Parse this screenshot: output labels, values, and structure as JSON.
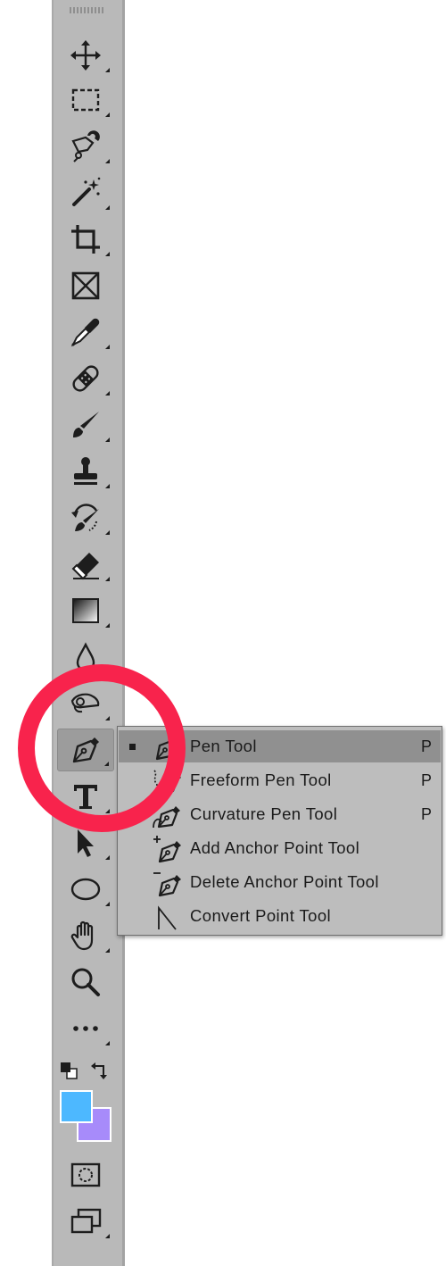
{
  "toolbar": {
    "tools": [
      {
        "name": "move-tool",
        "icon": "move-icon",
        "has_submenu": true
      },
      {
        "name": "rectangular-marquee-tool",
        "icon": "marquee-icon",
        "has_submenu": true
      },
      {
        "name": "magnetic-lasso-tool",
        "icon": "magnetic-lasso-icon",
        "has_submenu": true
      },
      {
        "name": "magic-wand-tool",
        "icon": "magic-wand-icon",
        "has_submenu": true
      },
      {
        "name": "crop-tool",
        "icon": "crop-icon",
        "has_submenu": true
      },
      {
        "name": "frame-tool",
        "icon": "frame-icon",
        "has_submenu": false
      },
      {
        "name": "eyedropper-tool",
        "icon": "eyedropper-icon",
        "has_submenu": true
      },
      {
        "name": "healing-brush-tool",
        "icon": "bandage-icon",
        "has_submenu": true
      },
      {
        "name": "brush-tool",
        "icon": "brush-icon",
        "has_submenu": true
      },
      {
        "name": "clone-stamp-tool",
        "icon": "stamp-icon",
        "has_submenu": true
      },
      {
        "name": "history-brush-tool",
        "icon": "history-brush-icon",
        "has_submenu": true
      },
      {
        "name": "eraser-tool",
        "icon": "eraser-icon",
        "has_submenu": true
      },
      {
        "name": "gradient-tool",
        "icon": "gradient-icon",
        "has_submenu": true
      },
      {
        "name": "blur-tool",
        "icon": "drop-icon",
        "has_submenu": true
      },
      {
        "name": "smudge-tool",
        "icon": "smudge-icon",
        "has_submenu": true
      },
      {
        "name": "pen-tool",
        "icon": "pen-icon",
        "has_submenu": true,
        "active": true
      },
      {
        "name": "type-tool",
        "icon": "type-icon",
        "has_submenu": true
      },
      {
        "name": "path-selection-tool",
        "icon": "arrow-icon",
        "has_submenu": true
      },
      {
        "name": "ellipse-tool",
        "icon": "ellipse-icon",
        "has_submenu": true
      },
      {
        "name": "hand-tool",
        "icon": "hand-icon",
        "has_submenu": true
      },
      {
        "name": "zoom-tool",
        "icon": "zoom-icon",
        "has_submenu": false
      },
      {
        "name": "edit-toolbar",
        "icon": "more-icon",
        "has_submenu": true
      }
    ],
    "foreground_color": "#4db8ff",
    "background_color": "#a78bfa"
  },
  "pen_menu": {
    "items": [
      {
        "label": "Pen Tool",
        "shortcut": "P",
        "icon": "pen-icon",
        "selected": true
      },
      {
        "label": "Freeform Pen Tool",
        "shortcut": "P",
        "icon": "freeform-pen-icon",
        "selected": false
      },
      {
        "label": "Curvature Pen Tool",
        "shortcut": "P",
        "icon": "curvature-pen-icon",
        "selected": false
      },
      {
        "label": "Add Anchor Point Tool",
        "shortcut": "",
        "icon": "add-anchor-icon",
        "selected": false
      },
      {
        "label": "Delete Anchor Point Tool",
        "shortcut": "",
        "icon": "delete-anchor-icon",
        "selected": false
      },
      {
        "label": "Convert Point Tool",
        "shortcut": "",
        "icon": "convert-point-icon",
        "selected": false
      }
    ]
  },
  "annotation": {
    "highlight_color": "#f8234c"
  }
}
